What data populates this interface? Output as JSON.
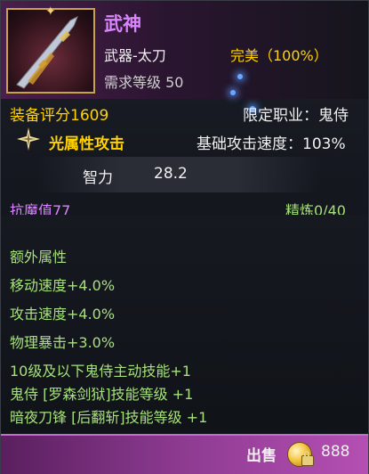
{
  "item": {
    "name": "武神",
    "type": "武器-太刀",
    "req_level": "需求等级 50",
    "quality": "完美（100%）",
    "score": "装备评分1609",
    "class_limit": "限定职业：鬼侍",
    "element_attack": "光属性攻击",
    "base_speed": "基础攻击速度：103%",
    "stat_name": "智力",
    "stat_value": "28.2",
    "magic_resist": "抗魔值77",
    "refine": "精炼0/40",
    "extra_header": "额外属性",
    "extra": [
      "移动速度+4.0%",
      "攻击速度+4.0%",
      "物理暴击+3.0%",
      "10级及以下鬼侍主动技能+1",
      "鬼侍 [罗森剑狱]技能等级 +1",
      "暗夜刀锋 [后翻斩]技能等级 +1"
    ]
  },
  "footer": {
    "sell_label": "出售",
    "price": "888"
  },
  "colors": {
    "name": "#d985ff",
    "gold": "#ffd200",
    "green": "#a6e07a",
    "footer": "#8e3b92"
  }
}
